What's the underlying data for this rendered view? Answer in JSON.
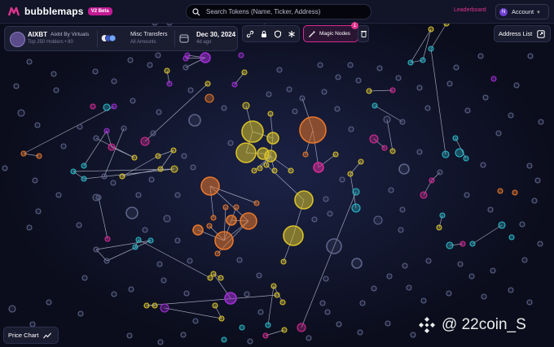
{
  "app": {
    "name": "bubblemaps",
    "badge": "V2 Beta"
  },
  "search": {
    "placeholder": "Search Tokens (Name, Ticker, Address)"
  },
  "nav": {
    "leaderboard": "Leaderboard",
    "account_initial": "N",
    "account_label": "Account"
  },
  "token": {
    "ticker": "AIXBT",
    "full_name": "Aixbt By Virtuals",
    "holders": "Top 250 Holders • 80"
  },
  "transfers": {
    "title": "Misc Transfers",
    "subtitle": "All Amounts"
  },
  "date": {
    "value": "Dec 30, 2024",
    "relative": "4d ago"
  },
  "toolbar": {
    "tools": [
      "link-icon",
      "lock-icon",
      "shield-icon",
      "asterisk-icon"
    ],
    "magic_label": "Magic Nodes",
    "magic_badge": "1"
  },
  "address_list": "Address List",
  "price_chart": "Price Chart",
  "watermark": "@ 22coin_S",
  "colors": {
    "background": "#0b0d1c",
    "accent": "#d92a95",
    "yellow": "#d9c22a",
    "orange": "#e8772a",
    "magenta": "#d92a95",
    "purple": "#a22fd6",
    "cyan": "#2ab9c8",
    "gray": "#5d6488"
  }
}
